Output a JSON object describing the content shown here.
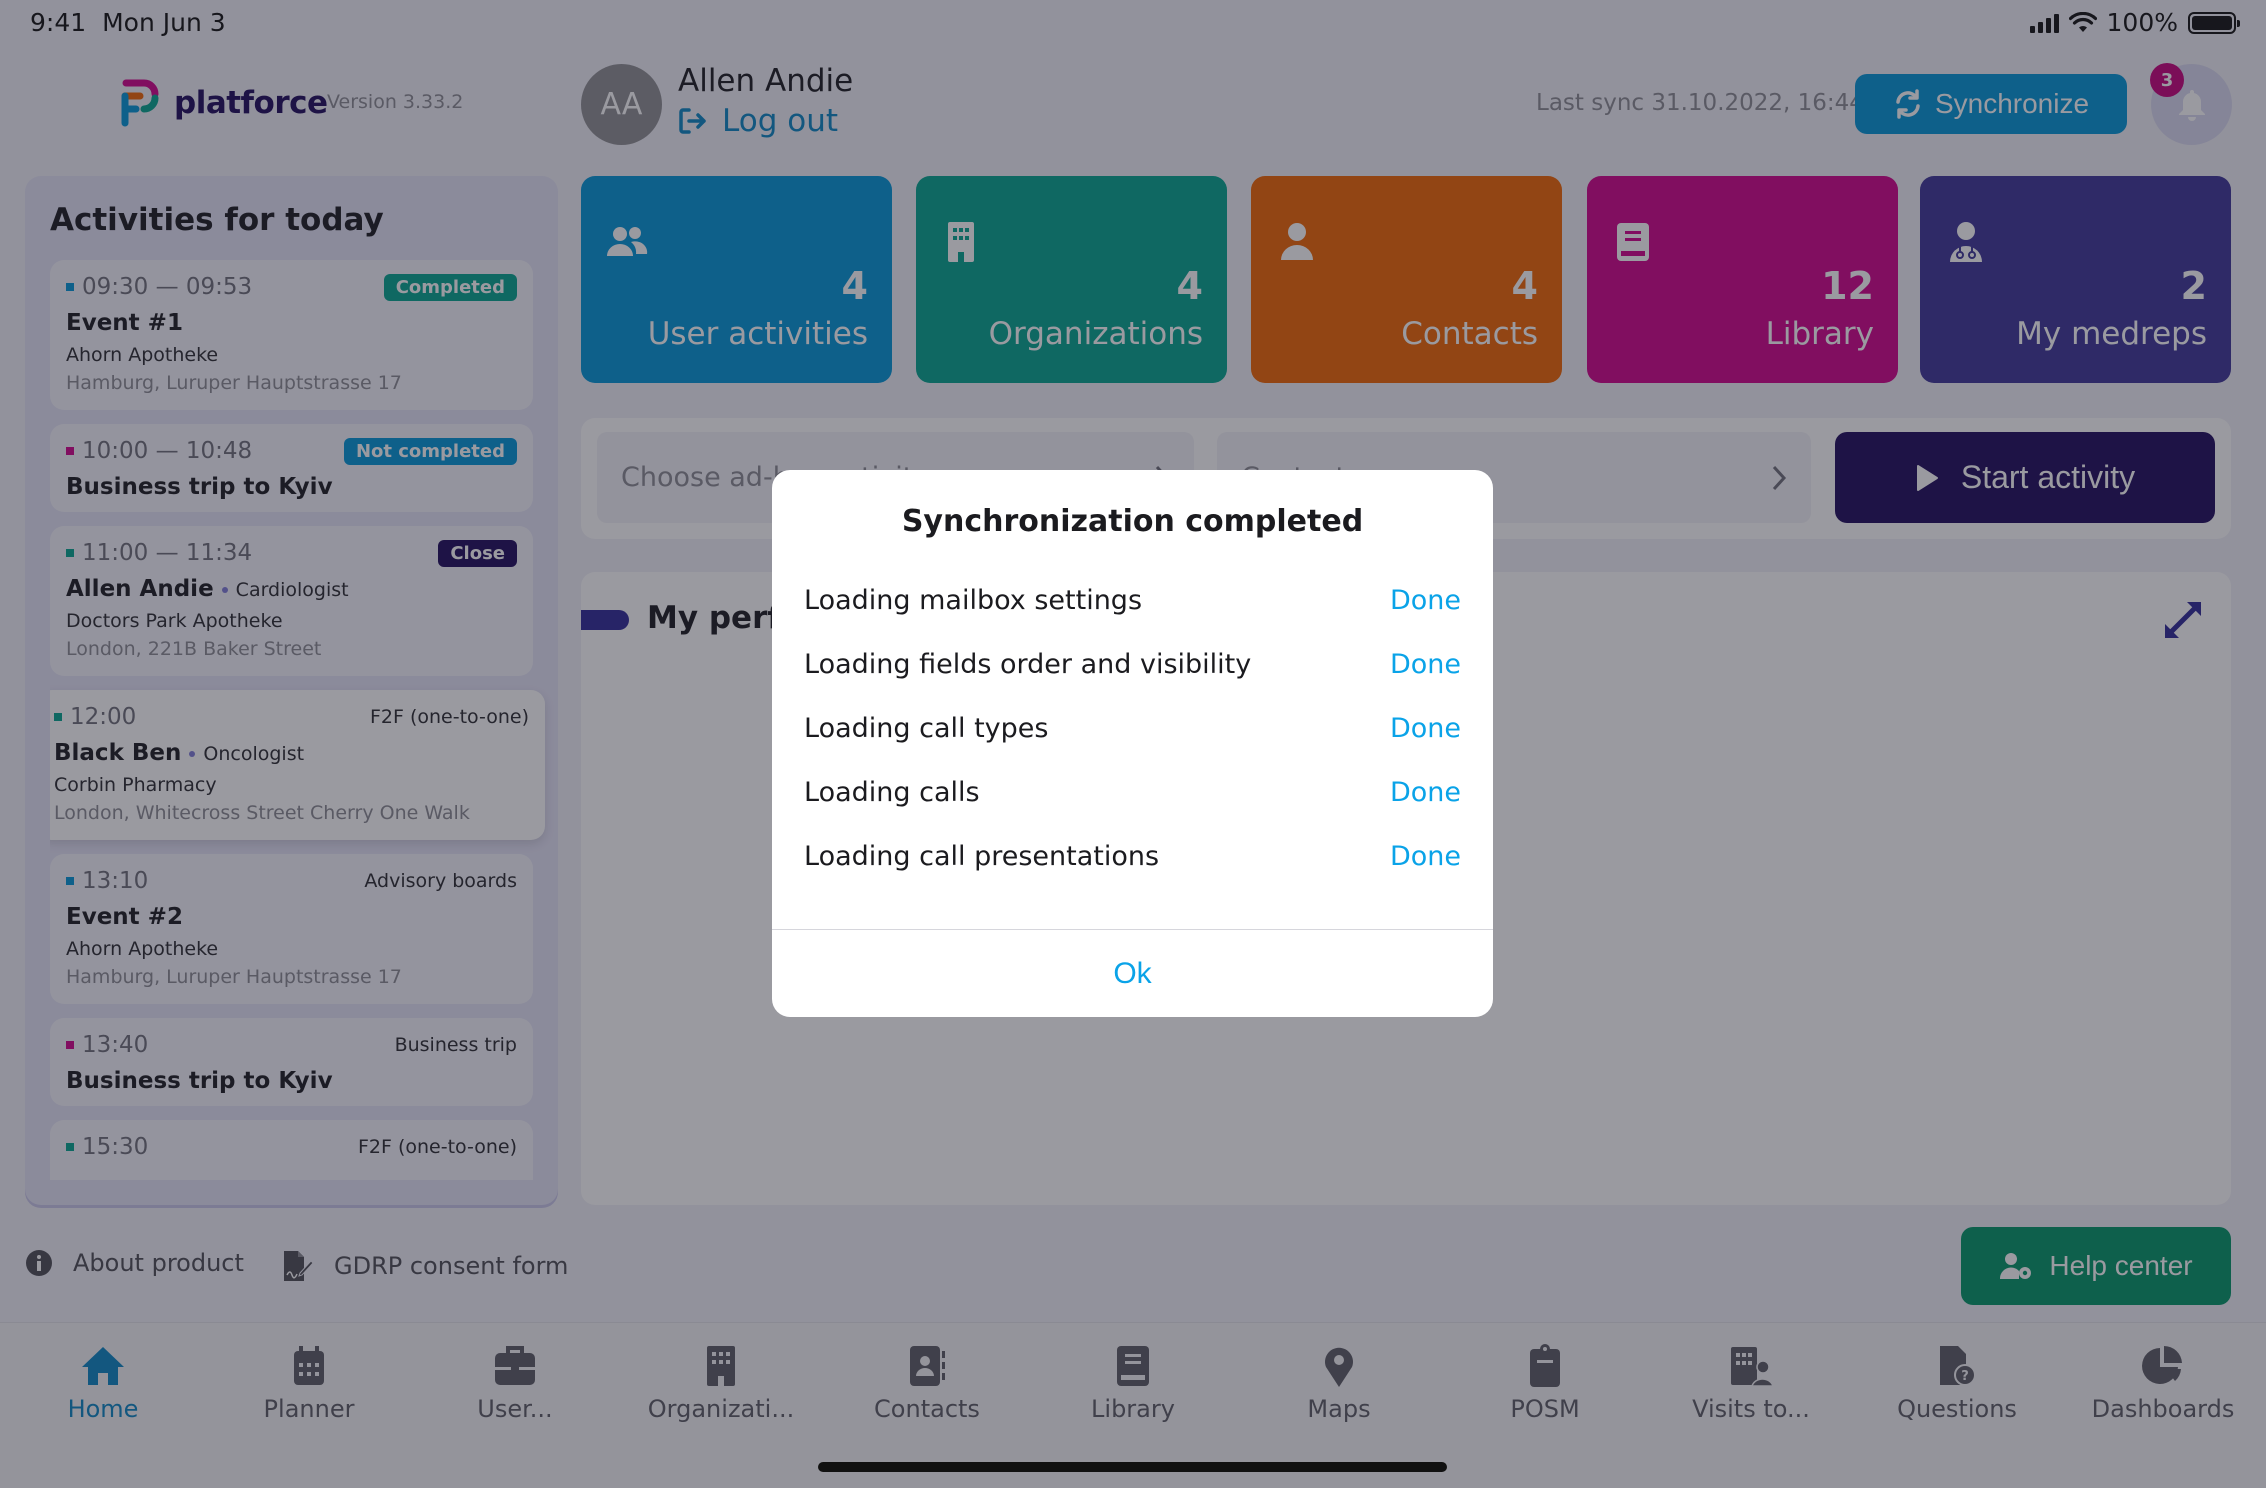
{
  "status_bar": {
    "time": "9:41",
    "date": "Mon Jun 3",
    "battery": "100%"
  },
  "header": {
    "brand": "platforce",
    "version": "Version 3.33.2",
    "avatar_initials": "AA",
    "user_name": "Allen Andie",
    "logout_label": "Log out",
    "last_sync": "Last sync 31.10.2022, 16:44",
    "sync_label": "Synchronize",
    "notifications_count": "3"
  },
  "colors": {
    "accent": "#0095d8",
    "primary_dark": "#1e0a5c",
    "tile_user_activities": "#0095d8",
    "tile_organizations": "#03a58e",
    "tile_contacts": "#f06500",
    "tile_library": "#d1008a",
    "tile_medreps": "#3c3498",
    "help_center": "#009566",
    "status_done": "#0aa3e8"
  },
  "activities": {
    "title": "Activities for today",
    "items": [
      {
        "time": "09:30 — 09:53",
        "dot_color": "#0095d8",
        "badge": "Completed",
        "badge_color": "#03a58e",
        "title": "Event #1",
        "specialty": "",
        "org": "Ahorn Apotheke",
        "address": "Hamburg, Luruper Hauptstrasse 17"
      },
      {
        "time": "10:00 — 10:48",
        "dot_color": "#d1008a",
        "badge": "Not completed",
        "badge_color": "#0095d8",
        "title": "Business trip to Kyiv",
        "specialty": "",
        "org": "",
        "address": ""
      },
      {
        "time": "11:00 — 11:34",
        "dot_color": "#03a58e",
        "badge": "Close",
        "badge_color": "#1e0a5c",
        "title": "Allen Andie",
        "specialty": "Cardiologist",
        "org": "Doctors Park Apotheke",
        "address": "London, 221B Baker Street"
      },
      {
        "time": "12:00",
        "dot_color": "#03a58e",
        "type": "F2F (one-to-one)",
        "title": "Black Ben",
        "specialty": "Oncologist",
        "org": "Corbin Pharmacy",
        "address": "London, Whitecross Street Cherry One Walk",
        "selected": true
      },
      {
        "time": "13:10",
        "dot_color": "#0095d8",
        "type": "Advisory boards",
        "title": "Event #2",
        "specialty": "",
        "org": "Ahorn Apotheke",
        "address": "Hamburg, Luruper Hauptstrasse 17"
      },
      {
        "time": "13:40",
        "dot_color": "#d1008a",
        "type": "Business trip",
        "title": "Business trip to Kyiv",
        "specialty": "",
        "org": "",
        "address": ""
      },
      {
        "time": "15:30",
        "dot_color": "#03a58e",
        "type": "F2F (one-to-one)",
        "title": "",
        "specialty": "",
        "org": "",
        "address": ""
      }
    ]
  },
  "tiles": [
    {
      "icon": "users-icon",
      "count": "4",
      "label": "User activities"
    },
    {
      "icon": "building-icon",
      "count": "4",
      "label": "Organizations"
    },
    {
      "icon": "person-icon",
      "count": "4",
      "label": "Contacts"
    },
    {
      "icon": "book-icon",
      "count": "12",
      "label": "Library"
    },
    {
      "icon": "doctor-icon",
      "count": "2",
      "label": "My medreps"
    }
  ],
  "activity_bar": {
    "dropdown1_placeholder": "Choose ad-hoc activity",
    "dropdown2_placeholder": "Contact",
    "start_label": "Start activity"
  },
  "performance": {
    "title": "My performance"
  },
  "footer": {
    "about_label": "About product",
    "gdrp_label": "GDRP consent form",
    "help_label": "Help center"
  },
  "tabbar": {
    "items": [
      {
        "label": "Home",
        "icon": "home-icon",
        "active": true
      },
      {
        "label": "Planner",
        "icon": "calendar-icon"
      },
      {
        "label": "User...",
        "icon": "briefcase-icon"
      },
      {
        "label": "Organizati...",
        "icon": "building-icon"
      },
      {
        "label": "Contacts",
        "icon": "contact-book-icon"
      },
      {
        "label": "Library",
        "icon": "book-icon"
      },
      {
        "label": "Maps",
        "icon": "map-pin-icon"
      },
      {
        "label": "POSM",
        "icon": "clipboard-icon"
      },
      {
        "label": "Visits to...",
        "icon": "building-user-icon"
      },
      {
        "label": "Questions",
        "icon": "file-question-icon"
      },
      {
        "label": "Dashboards",
        "icon": "pie-chart-icon"
      }
    ]
  },
  "dialog": {
    "title": "Synchronization completed",
    "rows": [
      {
        "label": "Loading mailbox settings",
        "status": "Done"
      },
      {
        "label": "Loading fields order and visibility",
        "status": "Done"
      },
      {
        "label": "Loading call types",
        "status": "Done"
      },
      {
        "label": "Loading calls",
        "status": "Done"
      },
      {
        "label": "Loading call presentations",
        "status": "Done"
      }
    ],
    "ok_label": "Ok"
  }
}
